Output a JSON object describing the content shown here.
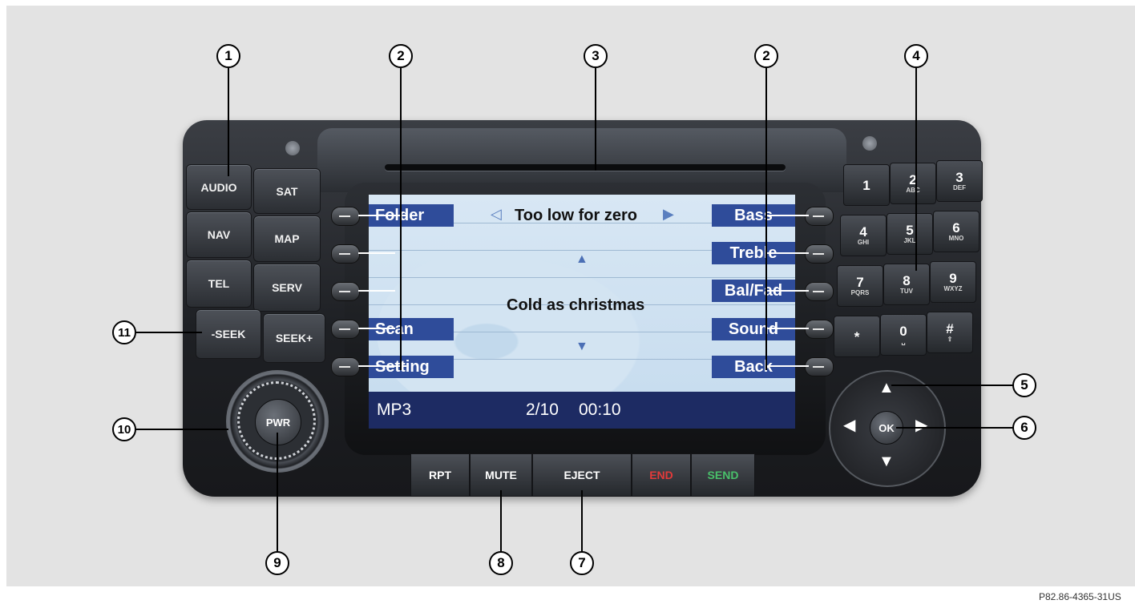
{
  "left_buttons": {
    "audio": "AUDIO",
    "sat": "SAT",
    "nav": "NAV",
    "map": "MAP",
    "tel": "TEL",
    "serv": "SERV",
    "seek_minus": "-SEEK",
    "seek_plus": "SEEK+"
  },
  "screen": {
    "left_softkeys": [
      "Folder",
      "Scan",
      "Setting"
    ],
    "right_softkeys": [
      "Bass",
      "Treble",
      "Bal/Fad",
      "Sound",
      "Back"
    ],
    "track_title": "Too low for zero",
    "song": "Cold as christmas",
    "source": "MP3",
    "track_position": "2/10",
    "elapsed_time": "00:10",
    "colors": {
      "softkey_bg": "#2f4c9a",
      "screen_bg": "#cfe1f1",
      "status_bg": "#1d2b63"
    }
  },
  "keypad": [
    {
      "n": "1",
      "l": ""
    },
    {
      "n": "2",
      "l": "ABC"
    },
    {
      "n": "3",
      "l": "DEF"
    },
    {
      "n": "4",
      "l": "GHI"
    },
    {
      "n": "5",
      "l": "JKL"
    },
    {
      "n": "6",
      "l": "MNO"
    },
    {
      "n": "7",
      "l": "PQRS"
    },
    {
      "n": "8",
      "l": "TUV"
    },
    {
      "n": "9",
      "l": "WXYZ"
    },
    {
      "n": "*",
      "l": ""
    },
    {
      "n": "0",
      "l": "␣"
    },
    {
      "n": "#",
      "l": "⇧"
    }
  ],
  "knob": {
    "label": "PWR"
  },
  "dpad": {
    "ok": "OK"
  },
  "bottom_bar": {
    "rpt": "RPT",
    "mute": "MUTE",
    "eject": "EJECT",
    "end": "END",
    "send": "SEND",
    "end_color": "#e23a3a",
    "send_color": "#49c06a"
  },
  "callouts": {
    "c1": "1",
    "c2": "2",
    "c3": "3",
    "c4": "4",
    "c5": "5",
    "c6": "6",
    "c7": "7",
    "c8": "8",
    "c9": "9",
    "c10": "10",
    "c11": "11"
  },
  "reference_code": "P82.86-4365-31US"
}
